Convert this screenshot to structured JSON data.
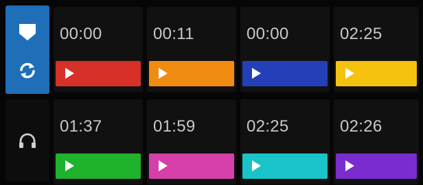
{
  "side": {
    "top_button": {
      "icons": [
        "shield-icon",
        "sync-icon"
      ],
      "color": "#1e6fb8"
    },
    "bottom_button": {
      "icon": "headphones-icon",
      "color": "#0d0d0d"
    }
  },
  "hot_cues": [
    {
      "time": "00:00",
      "color": "#d63028"
    },
    {
      "time": "00:11",
      "color": "#f08c12"
    },
    {
      "time": "00:00",
      "color": "#2440b8"
    },
    {
      "time": "02:25",
      "color": "#f5c210"
    },
    {
      "time": "01:37",
      "color": "#1fb22c"
    },
    {
      "time": "01:59",
      "color": "#d440a8"
    },
    {
      "time": "02:25",
      "color": "#18c4c8"
    },
    {
      "time": "02:26",
      "color": "#7a2cd0"
    }
  ]
}
